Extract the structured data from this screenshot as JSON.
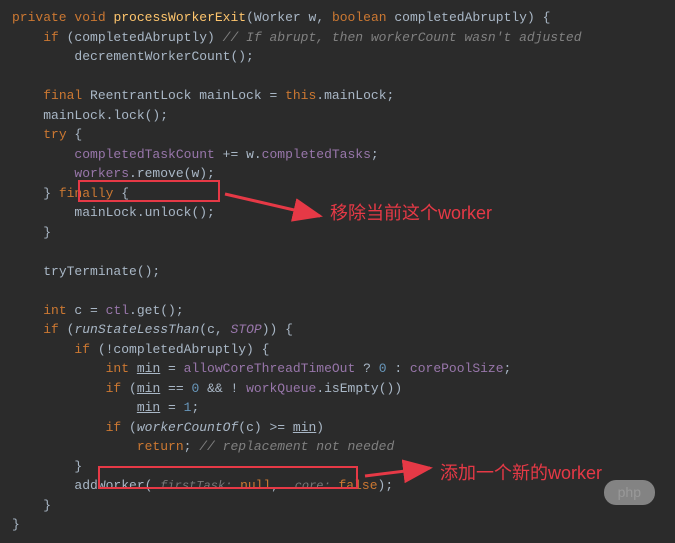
{
  "code": {
    "l1_private": "private",
    "l1_void": "void",
    "l1_method": "processWorkerExit",
    "l1_p1type": "Worker",
    "l1_p1": "w",
    "l1_p2type": "boolean",
    "l1_p2": "completedAbruptly",
    "l1_brace": ") {",
    "l2_if": "if",
    "l2_cond": " (completedAbruptly) ",
    "l2_comment": "// If abrupt, then workerCount wasn't adjusted",
    "l3": "decrementWorkerCount();",
    "l5_final": "final",
    "l5_type": " ReentrantLock mainLock = ",
    "l5_this": "this",
    "l5_field": ".mainLock;",
    "l6": "mainLock.lock();",
    "l7_try": "try",
    "l7_brace": " {",
    "l8_a": "completedTaskCount",
    "l8_b": " += w.",
    "l8_c": "completedTasks",
    "l8_d": ";",
    "l9_a": "workers",
    "l9_b": ".remove(w);",
    "l10_a": "} ",
    "l10_fin": "finally",
    "l10_b": " {",
    "l11": "mainLock.unlock();",
    "l12": "}",
    "l14": "tryTerminate();",
    "l16_int": "int",
    "l16_a": " c = ",
    "l16_ctl": "ctl",
    "l16_b": ".get();",
    "l17_if": "if",
    "l17_a": " (",
    "l17_m": "runStateLessThan",
    "l17_b": "(c, ",
    "l17_stop": "STOP",
    "l17_c": ")) {",
    "l18_if": "if",
    "l18_a": " (!completedAbruptly) {",
    "l19_int": "int",
    "l19_a": " ",
    "l19_min": "min",
    "l19_b": " = ",
    "l19_f1": "allowCoreThreadTimeOut",
    "l19_c": " ? ",
    "l19_zero": "0",
    "l19_d": " : ",
    "l19_f2": "corePoolSize",
    "l19_e": ";",
    "l20_if": "if",
    "l20_a": " (",
    "l20_min": "min",
    "l20_b": " == ",
    "l20_zero": "0",
    "l20_c": " && ! ",
    "l20_wq": "workQueue",
    "l20_d": ".isEmpty())",
    "l21_min": "min",
    "l21_a": " = ",
    "l21_one": "1",
    "l21_b": ";",
    "l22_if": "if",
    "l22_a": " (",
    "l22_m": "workerCountOf",
    "l22_b": "(c) >= ",
    "l22_min": "min",
    "l22_c": ")",
    "l23_ret": "return",
    "l23_a": "; ",
    "l23_comment": "// replacement not needed",
    "l24": "}",
    "l25_m": "addWorker",
    "l25_a": "( ",
    "l25_h1": "firstTask:",
    "l25_null": " null",
    "l25_b": ",  ",
    "l25_h2": "core:",
    "l25_false": " false",
    "l25_c": ");",
    "l26": "}",
    "l27": "}"
  },
  "annotations": {
    "remove_worker": "移除当前这个worker",
    "add_worker": "添加一个新的worker"
  },
  "watermark": "php"
}
